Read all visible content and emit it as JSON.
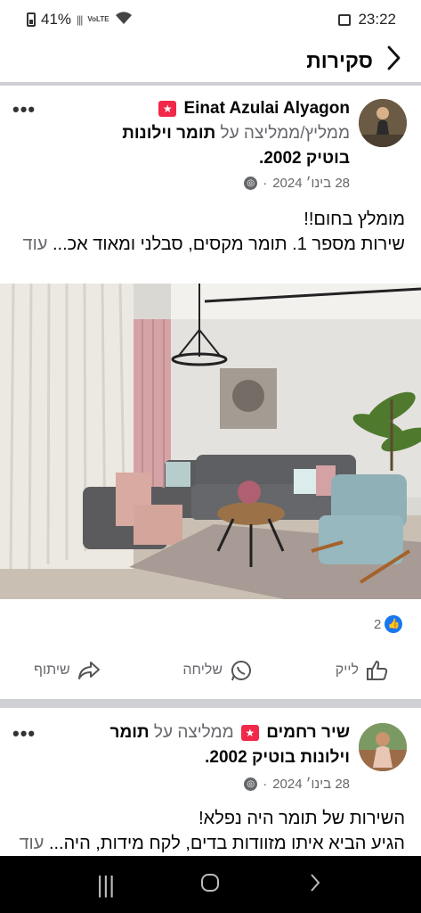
{
  "status_bar": {
    "battery": "41%",
    "volte": "VoLTE",
    "time": "23:22"
  },
  "header": {
    "title": "סקירות",
    "back_icon": "chevron-right-icon"
  },
  "reviews": [
    {
      "reviewer": "Einat Azulai Alyagon",
      "recommends_text": "ממליץ/ממליצה על",
      "page_name": "תומר וילונות בוטיק 2002",
      "date": "28 בינו׳ 2024",
      "line1": "מומלץ בחום!!",
      "line2": "שירות מספר 1. תומר מקסים, סבלני ומאוד אכ...",
      "more": "עוד",
      "reaction_count": "2"
    },
    {
      "reviewer": "שיר רחמים",
      "recommends_text": "ממליצה על",
      "page_name": "תומר וילונות בוטיק 2002",
      "date": "28 בינו׳ 2024",
      "line1": "השירות של תומר היה נפלא!",
      "line2": "הגיע הביא איתו מזוודות בדים, לקח מידות, היה...",
      "more": "עוד"
    }
  ],
  "actions": {
    "like": "לייק",
    "send": "שליחה",
    "share": "שיתוף"
  },
  "colors": {
    "accent": "#1877f2",
    "recommend_badge": "#f02849",
    "secondary_text": "#65676b"
  }
}
